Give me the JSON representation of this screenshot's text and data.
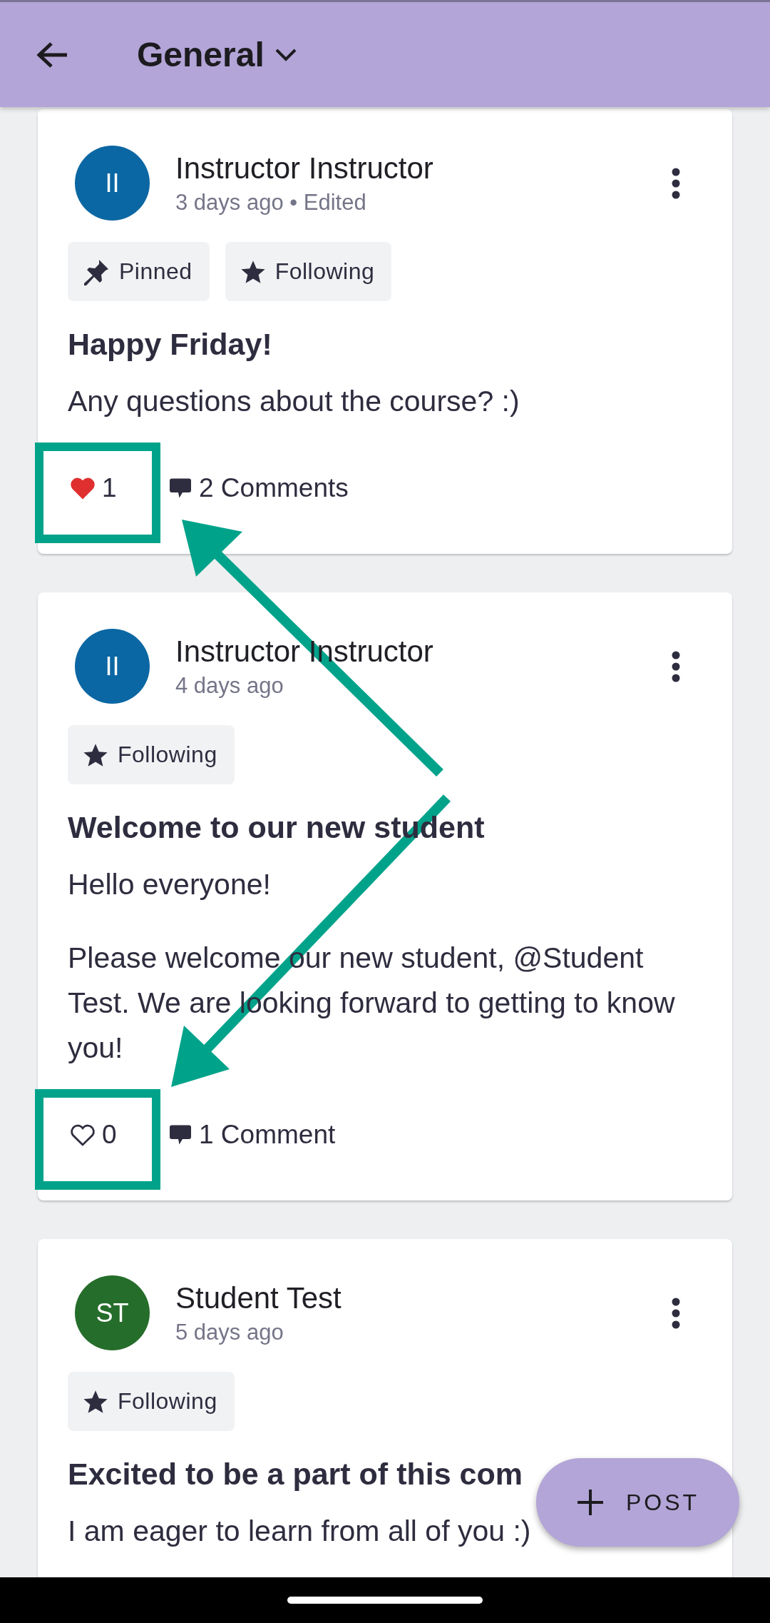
{
  "header": {
    "title": "General"
  },
  "posts": [
    {
      "author": "Instructor Instructor",
      "initials": "II",
      "color": "#0b67a3",
      "meta": "3 days ago • Edited",
      "tags": [
        {
          "kind": "pinned",
          "label": "Pinned"
        },
        {
          "kind": "following",
          "label": "Following"
        }
      ],
      "title": "Happy Friday!",
      "paragraphs": [
        "Any questions about the course? :)"
      ],
      "footer": {
        "liked": true,
        "likes": "1",
        "comments": "2 Comments",
        "highlighted": true
      }
    },
    {
      "author": "Instructor Instructor",
      "initials": "II",
      "color": "#0b67a3",
      "meta": "4 days ago",
      "tags": [
        {
          "kind": "following",
          "label": "Following"
        }
      ],
      "title": "Welcome to our new student",
      "paragraphs": [
        "Hello everyone!",
        "Please welcome our new student, @Student Test. We are looking forward to getting to know you!"
      ],
      "footer": {
        "liked": false,
        "likes": "0",
        "comments": "1 Comment",
        "highlighted": true
      }
    },
    {
      "author": "Student Test",
      "initials": "ST",
      "color": "#256d2b",
      "meta": "5 days ago",
      "tags": [
        {
          "kind": "following",
          "label": "Following"
        }
      ],
      "title": "Excited to be a part of this com",
      "paragraphs": [
        "I am eager to learn from all of you :)"
      ]
    }
  ],
  "fab": {
    "label": "POST"
  }
}
